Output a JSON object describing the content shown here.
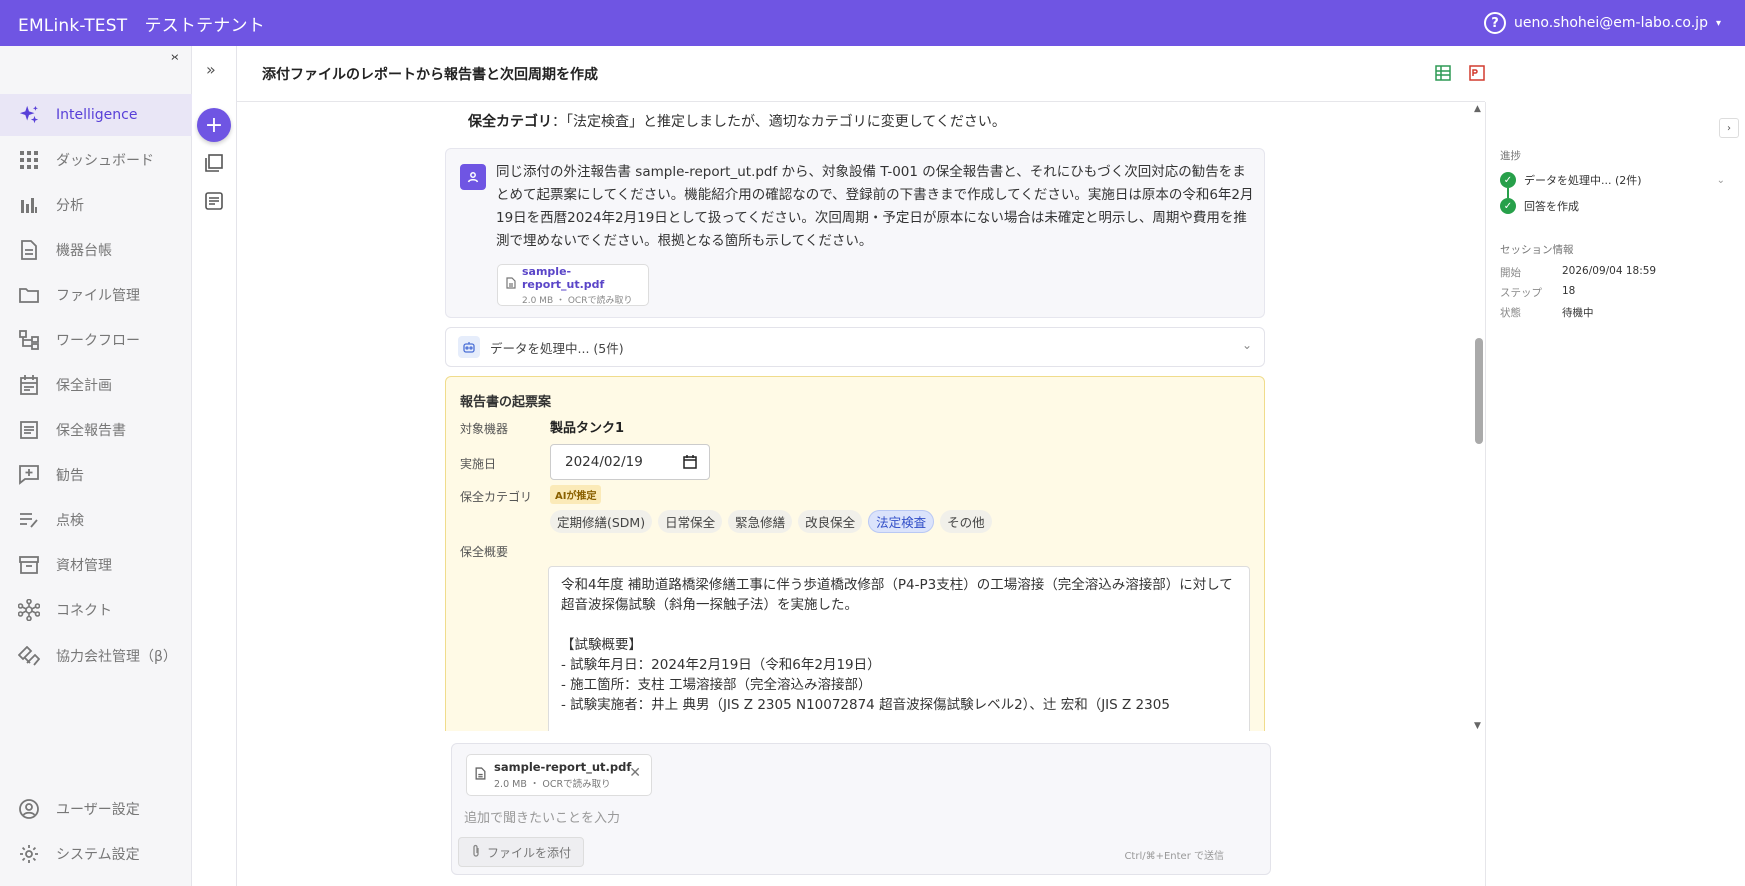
{
  "topbar": {
    "brand": "EMLink-TEST　テストテナント",
    "user": "ueno.shohei@em-labo.co.jp",
    "caret": "▾",
    "help": "?"
  },
  "sidebar": {
    "collapse": "›‹",
    "items": [
      {
        "label": "Intelligence",
        "icon": "sparkle-icon"
      },
      {
        "label": "ダッシュボード",
        "icon": "grid-icon"
      },
      {
        "label": "分析",
        "icon": "chart-icon"
      },
      {
        "label": "機器台帳",
        "icon": "document-icon"
      },
      {
        "label": "ファイル管理",
        "icon": "folder-icon"
      },
      {
        "label": "ワークフロー",
        "icon": "workflow-icon"
      },
      {
        "label": "保全計画",
        "icon": "calendar-icon"
      },
      {
        "label": "保全報告書",
        "icon": "report-icon"
      },
      {
        "label": "勧告",
        "icon": "advice-icon"
      },
      {
        "label": "点検",
        "icon": "checklist-icon"
      },
      {
        "label": "資材管理",
        "icon": "archive-icon"
      },
      {
        "label": "コネクト",
        "icon": "network-icon"
      },
      {
        "label": "協力会社管理（β）",
        "icon": "handshake-icon"
      },
      {
        "label": "ユーザー設定",
        "icon": "user-circle-icon"
      },
      {
        "label": "システム設定",
        "icon": "gear-icon"
      }
    ]
  },
  "rail": {
    "expand": "»",
    "plus": "+"
  },
  "header": {
    "title": "添付ファイルのレポートから報告書と次回周期を作成"
  },
  "chat": {
    "category_label": "保全カテゴリ",
    "category_note": "：「法定検査」と推定しましたが、適切なカテゴリに変更してください。",
    "user_message": "同じ添付の外注報告書 sample-report_ut.pdf から、対象設備 T-001 の保全報告書と、それにひもづく次回対応の勧告をまとめて起票案にしてください。機能紹介用の確認なので、登録前の下書きまで作成してください。実施日は原本の令和6年2月19日を西暦2024年2月19日として扱ってください。次回周期・予定日が原本にない場合は未確定と明示し、周期や費用を推測で埋めないでください。根拠となる箇所も示してください。",
    "attachment": {
      "name": "sample-report_ut.pdf",
      "meta": "2.0 MB ・ OCRで読み取り"
    },
    "processing": "データを処理中... (5件)"
  },
  "report": {
    "title": "報告書の起票案",
    "equipment_label": "対象機器",
    "equipment_value": "製品タンク1",
    "date_label": "実施日",
    "date_value": "2024/02/19",
    "category_label": "保全カテゴリ",
    "ai_badge": "AIが推定",
    "categories": [
      "定期修繕(SDM)",
      "日常保全",
      "緊急修繕",
      "改良保全",
      "法定検査",
      "その他"
    ],
    "selected_category": "法定検査",
    "summary_label": "保全概要",
    "summary": "令和4年度 補助道路橋梁修繕工事に伴う歩道橋改修部（P4-P3支柱）の工場溶接（完全溶込み溶接部）に対して超音波探傷試験（斜角一探触子法）を実施した。\n\n【試験概要】\n- 試験年月日：2024年2月19日（令和6年2月19日）\n- 施工箇所：支柱 工場溶接部（完全溶込み溶接部）\n- 試験実施者：井上 典男（JIS Z 2305 N10072874 超音波探傷試験レベル2）、辻 宏和（JIS Z 2305"
  },
  "composer": {
    "attachment": {
      "name": "sample-report_ut.pdf",
      "meta": "2.0 MB ・ OCRで読み取り"
    },
    "placeholder": "追加で聞きたいことを入力",
    "attach_button": "ファイルを添付",
    "hint": "Ctrl/⌘+Enter で送信"
  },
  "rpanel": {
    "progress_title": "進捗",
    "steps": [
      {
        "label": "データを処理中... (2件)"
      },
      {
        "label": "回答を作成"
      }
    ],
    "session_title": "セッション情報",
    "session": [
      {
        "key": "開始",
        "value": "2026/09/04 18:59"
      },
      {
        "key": "ステップ",
        "value": "18"
      },
      {
        "key": "状態",
        "value": "待機中"
      }
    ]
  },
  "colors": {
    "brand": "#6f55e3",
    "success": "#27a04a",
    "selected_chip": "#3350c8"
  }
}
